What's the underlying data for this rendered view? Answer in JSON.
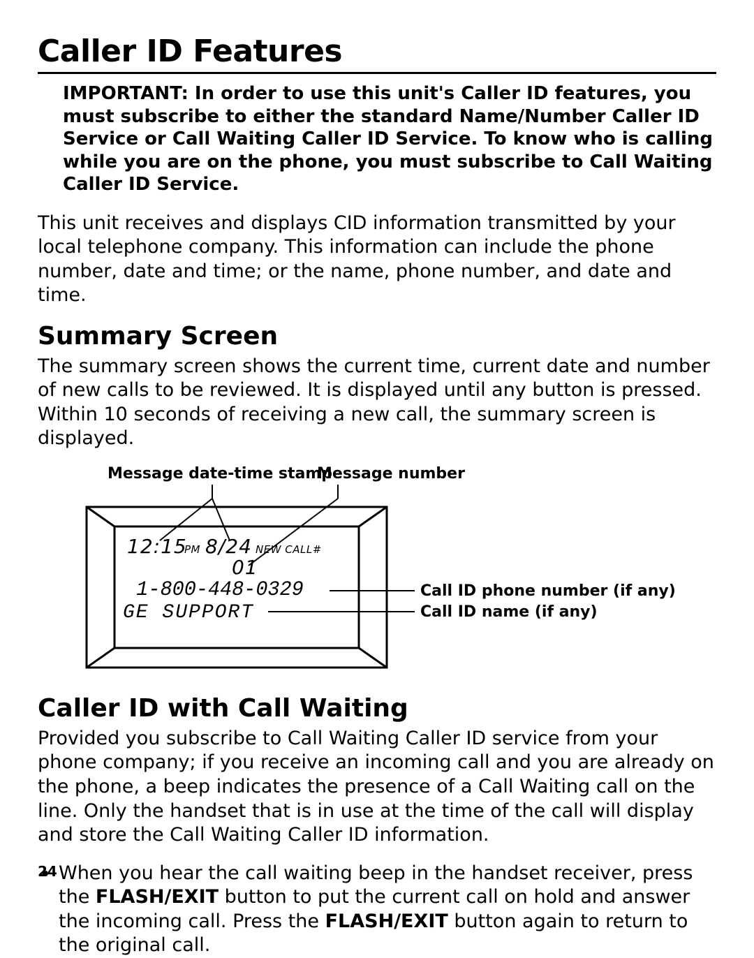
{
  "title": "Caller ID Features",
  "important": "IMPORTANT: In order to use this unit's Caller ID features, you must subscribe to either the standard Name/Number Caller ID Service or Call Waiting Caller ID Service. To know who is calling while you are on the phone, you must subscribe to Call Waiting Caller ID Service.",
  "intro": "This unit receives and displays CID information transmitted by your local telephone company. This information can include the phone number, date and time; or the name, phone number, and date and time.",
  "summary": {
    "heading": "Summary Screen",
    "body": "The summary screen shows the current time, current date and number of new calls to be reviewed. It is displayed until any button is pressed. Within 10 seconds of receiving a new call, the summary screen is displayed."
  },
  "figure": {
    "callout_datetime": "Message date-time stamp",
    "callout_msgnum": "Message number",
    "callout_phone": "Call ID phone number (if any)",
    "callout_name": "Call ID name (if any)",
    "lcd": {
      "time": "12:15",
      "ampm": "PM",
      "date": "8/24",
      "newcall_label": "NEW CALL#",
      "count": "01",
      "phone": "1-800-448-0329",
      "name": "GE  SUPPORT"
    }
  },
  "callwaiting": {
    "heading": "Caller ID with Call Waiting",
    "body": "Provided you subscribe to Call Waiting Caller ID service from your phone company; if you receive an incoming call and you are already on the phone, a beep indicates the presence of a Call Waiting call on the line. Only the handset that is in use at the time of the call will display and store the Call Waiting Caller ID information.",
    "bullet_pre": "When you hear the call waiting beep in the handset receiver, press the ",
    "flash_exit": "FLASH/EXIT",
    "bullet_mid": " button to put the current call on hold and answer the incoming call. Press the ",
    "bullet_post": " button again to return to the original call."
  },
  "page_number": "24"
}
